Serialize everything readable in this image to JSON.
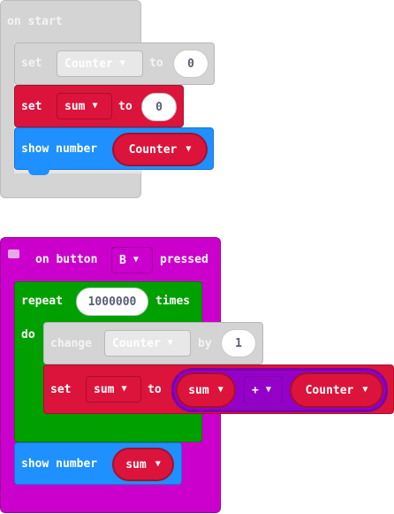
{
  "on_start_block": {
    "label": "on start",
    "set_counter": {
      "set": "set",
      "variable": "Counter",
      "to": "to",
      "value": "0"
    },
    "set_sum": {
      "set": "set",
      "variable": "sum",
      "to": "to",
      "value": "0"
    },
    "show_number": {
      "label": "show number",
      "variable": "Counter"
    }
  },
  "button_block": {
    "label_on_button": "on button",
    "button": "B",
    "label_pressed": "pressed",
    "repeat": {
      "label": "repeat",
      "count": "1000000",
      "times": "times",
      "do": "do"
    },
    "change": {
      "label": "change",
      "variable": "Counter",
      "by": "by",
      "value": "1"
    },
    "set_sum": {
      "set": "set",
      "variable": "sum",
      "to": "to",
      "left": "sum",
      "operator": "+",
      "right": "Counter"
    },
    "show_number": {
      "label": "show number",
      "variable": "sum"
    }
  },
  "colors": {
    "disabled": "#d4d4d4",
    "variables": "#dc143c",
    "basic": "#1e90ff",
    "loops": "#00a000",
    "input": "#cc00cc",
    "math": "#9400c8"
  },
  "icons": {
    "comment": "comment-icon",
    "dropdown": "chevron-down-icon"
  }
}
